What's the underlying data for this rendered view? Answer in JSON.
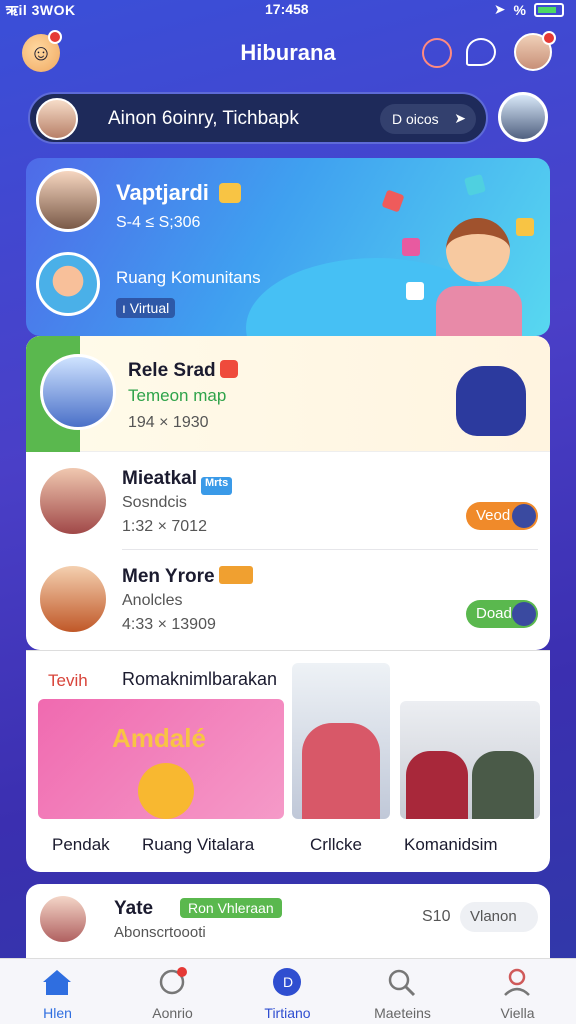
{
  "status_bar": {
    "carrier": "ऋil 3WOK",
    "time": "17:458",
    "battery": "%"
  },
  "header": {
    "title": "Hiburana"
  },
  "search": {
    "text": "Ainon 6oinry, Tichbapk",
    "pill": "D oicos"
  },
  "hero": {
    "item1": {
      "name": "Vaptjardi",
      "sub": "S-4 ≤ S;306"
    },
    "item2": {
      "name": "Ruang Komunitans",
      "tag": "ı Virtual"
    }
  },
  "featured": {
    "name": "Rele Srad",
    "sub": "Temeon map",
    "num": "194 × 1930"
  },
  "rows": [
    {
      "name": "Mieatkal",
      "sub": "Sosndcis",
      "num": "1:32 × 7012",
      "button": "Veod",
      "chip": "Mrts",
      "btn_color": "#f08a2a",
      "chip_color": "#3a9ae8"
    },
    {
      "name": "Men Yrore",
      "sub": "Anolcles",
      "num": "4:33 × 13909",
      "button": "Doad",
      "chip": "",
      "btn_color": "#5ab84e",
      "chip_color": "#f0a030"
    }
  ],
  "section": {
    "title_left": "Tevih",
    "title": "Romaknimlbarakan",
    "banner_text": "Amdalé",
    "labels": [
      "Pendak",
      "Ruang Vitalara",
      "Crllcke",
      "Komanidsim"
    ]
  },
  "bottom_card": {
    "name": "Yate",
    "chip": "Ron Vhleraan",
    "sub": "Abonscrtoooti",
    "price": "S10",
    "button": "Vlanon"
  },
  "nav": [
    {
      "label": "Hlen",
      "icon": "home-icon"
    },
    {
      "label": "Aonrio",
      "icon": "chat-icon"
    },
    {
      "label": "Tirtiano",
      "icon": "center-icon"
    },
    {
      "label": "Maeteins",
      "icon": "search-icon"
    },
    {
      "label": "Viella",
      "icon": "profile-icon"
    }
  ]
}
